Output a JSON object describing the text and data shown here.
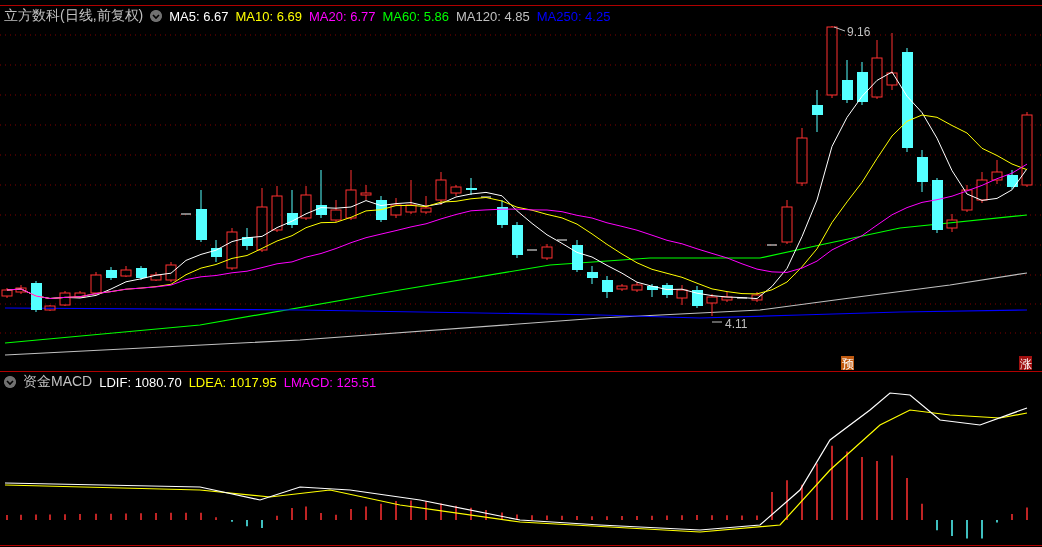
{
  "main_panel": {
    "title": "立方数科(日线,前复权)",
    "indicators": [
      {
        "label": "MA5: 6.67",
        "color": "#ffffff"
      },
      {
        "label": "MA10: 6.69",
        "color": "#ffff00"
      },
      {
        "label": "MA20: 6.77",
        "color": "#ff00ff"
      },
      {
        "label": "MA60: 5.86",
        "color": "#00ff00"
      },
      {
        "label": "MA120: 4.85",
        "color": "#c0c0c0"
      },
      {
        "label": "MA250: 4.25",
        "color": "#0000ff"
      }
    ],
    "high_label": "9.16",
    "low_label": "4.11",
    "badges": [
      {
        "text": "预",
        "color": "#c05a10"
      },
      {
        "text": "涨",
        "color": "#a01010"
      }
    ]
  },
  "macd_panel": {
    "title": "资金MACD",
    "indicators": [
      {
        "label": "LDIF: 1080.70",
        "color": "#ffffff"
      },
      {
        "label": "LDEA: 1017.95",
        "color": "#ffff00"
      },
      {
        "label": "LMACD: 125.51",
        "color": "#ff00ff"
      }
    ]
  }
}
